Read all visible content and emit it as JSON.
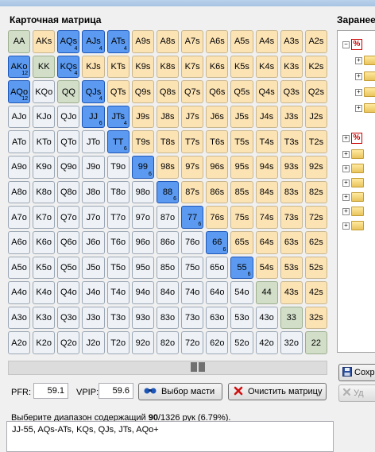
{
  "matrix": {
    "title": "Карточная матрица",
    "rows": [
      [
        {
          "l": "AA",
          "t": "pair"
        },
        {
          "l": "AKs",
          "t": "suited"
        },
        {
          "l": "AQs",
          "t": "suited",
          "s": true,
          "b": "4"
        },
        {
          "l": "AJs",
          "t": "suited",
          "s": true,
          "b": "4"
        },
        {
          "l": "ATs",
          "t": "suited",
          "s": true,
          "b": "4"
        },
        {
          "l": "A9s",
          "t": "suited"
        },
        {
          "l": "A8s",
          "t": "suited"
        },
        {
          "l": "A7s",
          "t": "suited"
        },
        {
          "l": "A6s",
          "t": "suited"
        },
        {
          "l": "A5s",
          "t": "suited"
        },
        {
          "l": "A4s",
          "t": "suited"
        },
        {
          "l": "A3s",
          "t": "suited"
        },
        {
          "l": "A2s",
          "t": "suited"
        }
      ],
      [
        {
          "l": "AKo",
          "t": "offsuit",
          "s": true,
          "b": "12"
        },
        {
          "l": "KK",
          "t": "pair"
        },
        {
          "l": "KQs",
          "t": "suited",
          "s": true,
          "b": "4"
        },
        {
          "l": "KJs",
          "t": "suited"
        },
        {
          "l": "KTs",
          "t": "suited"
        },
        {
          "l": "K9s",
          "t": "suited"
        },
        {
          "l": "K8s",
          "t": "suited"
        },
        {
          "l": "K7s",
          "t": "suited"
        },
        {
          "l": "K6s",
          "t": "suited"
        },
        {
          "l": "K5s",
          "t": "suited"
        },
        {
          "l": "K4s",
          "t": "suited"
        },
        {
          "l": "K3s",
          "t": "suited"
        },
        {
          "l": "K2s",
          "t": "suited"
        }
      ],
      [
        {
          "l": "AQo",
          "t": "offsuit",
          "s": true,
          "b": "12"
        },
        {
          "l": "KQo",
          "t": "offsuit"
        },
        {
          "l": "QQ",
          "t": "pair"
        },
        {
          "l": "QJs",
          "t": "suited",
          "s": true,
          "b": "4"
        },
        {
          "l": "QTs",
          "t": "suited"
        },
        {
          "l": "Q9s",
          "t": "suited"
        },
        {
          "l": "Q8s",
          "t": "suited"
        },
        {
          "l": "Q7s",
          "t": "suited"
        },
        {
          "l": "Q6s",
          "t": "suited"
        },
        {
          "l": "Q5s",
          "t": "suited"
        },
        {
          "l": "Q4s",
          "t": "suited"
        },
        {
          "l": "Q3s",
          "t": "suited"
        },
        {
          "l": "Q2s",
          "t": "suited"
        }
      ],
      [
        {
          "l": "AJo",
          "t": "offsuit"
        },
        {
          "l": "KJo",
          "t": "offsuit"
        },
        {
          "l": "QJo",
          "t": "offsuit"
        },
        {
          "l": "JJ",
          "t": "pair",
          "s": true,
          "b": "6"
        },
        {
          "l": "JTs",
          "t": "suited",
          "s": true,
          "b": "4"
        },
        {
          "l": "J9s",
          "t": "suited"
        },
        {
          "l": "J8s",
          "t": "suited"
        },
        {
          "l": "J7s",
          "t": "suited"
        },
        {
          "l": "J6s",
          "t": "suited"
        },
        {
          "l": "J5s",
          "t": "suited"
        },
        {
          "l": "J4s",
          "t": "suited"
        },
        {
          "l": "J3s",
          "t": "suited"
        },
        {
          "l": "J2s",
          "t": "suited"
        }
      ],
      [
        {
          "l": "ATo",
          "t": "offsuit"
        },
        {
          "l": "KTo",
          "t": "offsuit"
        },
        {
          "l": "QTo",
          "t": "offsuit"
        },
        {
          "l": "JTo",
          "t": "offsuit"
        },
        {
          "l": "TT",
          "t": "pair",
          "s": true,
          "b": "6"
        },
        {
          "l": "T9s",
          "t": "suited"
        },
        {
          "l": "T8s",
          "t": "suited"
        },
        {
          "l": "T7s",
          "t": "suited"
        },
        {
          "l": "T6s",
          "t": "suited"
        },
        {
          "l": "T5s",
          "t": "suited"
        },
        {
          "l": "T4s",
          "t": "suited"
        },
        {
          "l": "T3s",
          "t": "suited"
        },
        {
          "l": "T2s",
          "t": "suited"
        }
      ],
      [
        {
          "l": "A9o",
          "t": "offsuit"
        },
        {
          "l": "K9o",
          "t": "offsuit"
        },
        {
          "l": "Q9o",
          "t": "offsuit"
        },
        {
          "l": "J9o",
          "t": "offsuit"
        },
        {
          "l": "T9o",
          "t": "offsuit"
        },
        {
          "l": "99",
          "t": "pair",
          "s": true,
          "b": "6"
        },
        {
          "l": "98s",
          "t": "suited"
        },
        {
          "l": "97s",
          "t": "suited"
        },
        {
          "l": "96s",
          "t": "suited"
        },
        {
          "l": "95s",
          "t": "suited"
        },
        {
          "l": "94s",
          "t": "suited"
        },
        {
          "l": "93s",
          "t": "suited"
        },
        {
          "l": "92s",
          "t": "suited"
        }
      ],
      [
        {
          "l": "A8o",
          "t": "offsuit"
        },
        {
          "l": "K8o",
          "t": "offsuit"
        },
        {
          "l": "Q8o",
          "t": "offsuit"
        },
        {
          "l": "J8o",
          "t": "offsuit"
        },
        {
          "l": "T8o",
          "t": "offsuit"
        },
        {
          "l": "98o",
          "t": "offsuit"
        },
        {
          "l": "88",
          "t": "pair",
          "s": true,
          "b": "6"
        },
        {
          "l": "87s",
          "t": "suited"
        },
        {
          "l": "86s",
          "t": "suited"
        },
        {
          "l": "85s",
          "t": "suited"
        },
        {
          "l": "84s",
          "t": "suited"
        },
        {
          "l": "83s",
          "t": "suited"
        },
        {
          "l": "82s",
          "t": "suited"
        }
      ],
      [
        {
          "l": "A7o",
          "t": "offsuit"
        },
        {
          "l": "K7o",
          "t": "offsuit"
        },
        {
          "l": "Q7o",
          "t": "offsuit"
        },
        {
          "l": "J7o",
          "t": "offsuit"
        },
        {
          "l": "T7o",
          "t": "offsuit"
        },
        {
          "l": "97o",
          "t": "offsuit"
        },
        {
          "l": "87o",
          "t": "offsuit"
        },
        {
          "l": "77",
          "t": "pair",
          "s": true,
          "b": "6"
        },
        {
          "l": "76s",
          "t": "suited"
        },
        {
          "l": "75s",
          "t": "suited"
        },
        {
          "l": "74s",
          "t": "suited"
        },
        {
          "l": "73s",
          "t": "suited"
        },
        {
          "l": "72s",
          "t": "suited"
        }
      ],
      [
        {
          "l": "A6o",
          "t": "offsuit"
        },
        {
          "l": "K6o",
          "t": "offsuit"
        },
        {
          "l": "Q6o",
          "t": "offsuit"
        },
        {
          "l": "J6o",
          "t": "offsuit"
        },
        {
          "l": "T6o",
          "t": "offsuit"
        },
        {
          "l": "96o",
          "t": "offsuit"
        },
        {
          "l": "86o",
          "t": "offsuit"
        },
        {
          "l": "76o",
          "t": "offsuit"
        },
        {
          "l": "66",
          "t": "pair",
          "s": true,
          "b": "6"
        },
        {
          "l": "65s",
          "t": "suited"
        },
        {
          "l": "64s",
          "t": "suited"
        },
        {
          "l": "63s",
          "t": "suited"
        },
        {
          "l": "62s",
          "t": "suited"
        }
      ],
      [
        {
          "l": "A5o",
          "t": "offsuit"
        },
        {
          "l": "K5o",
          "t": "offsuit"
        },
        {
          "l": "Q5o",
          "t": "offsuit"
        },
        {
          "l": "J5o",
          "t": "offsuit"
        },
        {
          "l": "T5o",
          "t": "offsuit"
        },
        {
          "l": "95o",
          "t": "offsuit"
        },
        {
          "l": "85o",
          "t": "offsuit"
        },
        {
          "l": "75o",
          "t": "offsuit"
        },
        {
          "l": "65o",
          "t": "offsuit"
        },
        {
          "l": "55",
          "t": "pair",
          "s": true,
          "b": "6"
        },
        {
          "l": "54s",
          "t": "suited"
        },
        {
          "l": "53s",
          "t": "suited"
        },
        {
          "l": "52s",
          "t": "suited"
        }
      ],
      [
        {
          "l": "A4o",
          "t": "offsuit"
        },
        {
          "l": "K4o",
          "t": "offsuit"
        },
        {
          "l": "Q4o",
          "t": "offsuit"
        },
        {
          "l": "J4o",
          "t": "offsuit"
        },
        {
          "l": "T4o",
          "t": "offsuit"
        },
        {
          "l": "94o",
          "t": "offsuit"
        },
        {
          "l": "84o",
          "t": "offsuit"
        },
        {
          "l": "74o",
          "t": "offsuit"
        },
        {
          "l": "64o",
          "t": "offsuit"
        },
        {
          "l": "54o",
          "t": "offsuit"
        },
        {
          "l": "44",
          "t": "pair"
        },
        {
          "l": "43s",
          "t": "suited"
        },
        {
          "l": "42s",
          "t": "suited"
        }
      ],
      [
        {
          "l": "A3o",
          "t": "offsuit"
        },
        {
          "l": "K3o",
          "t": "offsuit"
        },
        {
          "l": "Q3o",
          "t": "offsuit"
        },
        {
          "l": "J3o",
          "t": "offsuit"
        },
        {
          "l": "T3o",
          "t": "offsuit"
        },
        {
          "l": "93o",
          "t": "offsuit"
        },
        {
          "l": "83o",
          "t": "offsuit"
        },
        {
          "l": "73o",
          "t": "offsuit"
        },
        {
          "l": "63o",
          "t": "offsuit"
        },
        {
          "l": "53o",
          "t": "offsuit"
        },
        {
          "l": "43o",
          "t": "offsuit"
        },
        {
          "l": "33",
          "t": "pair"
        },
        {
          "l": "32s",
          "t": "suited"
        }
      ],
      [
        {
          "l": "A2o",
          "t": "offsuit"
        },
        {
          "l": "K2o",
          "t": "offsuit"
        },
        {
          "l": "Q2o",
          "t": "offsuit"
        },
        {
          "l": "J2o",
          "t": "offsuit"
        },
        {
          "l": "T2o",
          "t": "offsuit"
        },
        {
          "l": "92o",
          "t": "offsuit"
        },
        {
          "l": "82o",
          "t": "offsuit"
        },
        {
          "l": "72o",
          "t": "offsuit"
        },
        {
          "l": "62o",
          "t": "offsuit"
        },
        {
          "l": "52o",
          "t": "offsuit"
        },
        {
          "l": "42o",
          "t": "offsuit"
        },
        {
          "l": "32o",
          "t": "offsuit"
        },
        {
          "l": "22",
          "t": "pair"
        }
      ]
    ]
  },
  "controls": {
    "pfr_label": "PFR:",
    "pfr_value": "59.1",
    "vpip_label": "VPIP:",
    "vpip_value": "59.6",
    "suit_select_button": "Выбор масти",
    "clear_matrix_button": "Очистить матрицу"
  },
  "status": {
    "prefix": "Выберите диапазон содержащий ",
    "selected_count": "90",
    "suffix": "/1326 рук (6.79%)."
  },
  "range_text": "JJ-55, AQs-ATs, KQs, QJs, JTs, AQo+",
  "sidebar": {
    "title": "Заранее",
    "save_button": "Сохр",
    "delete_button": "Уд"
  },
  "colors": {
    "suited": "#fce3b4",
    "offsuit": "#eef2f7",
    "pair": "#d2dec8",
    "selected": "#5b9af0"
  }
}
